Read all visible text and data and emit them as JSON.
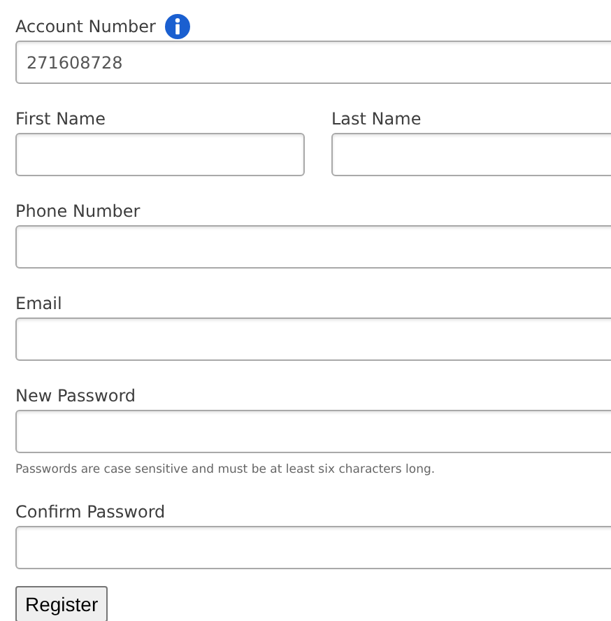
{
  "account_number": {
    "label": "Account Number",
    "value": "271608728"
  },
  "first_name": {
    "label": "First Name"
  },
  "last_name": {
    "label": "Last Name"
  },
  "phone_number": {
    "label": "Phone Number"
  },
  "email": {
    "label": "Email"
  },
  "new_password": {
    "label": "New Password",
    "hint": "Passwords are case sensitive and must be at least six characters long."
  },
  "confirm_password": {
    "label": "Confirm Password"
  },
  "register_button": {
    "label": "Register"
  }
}
